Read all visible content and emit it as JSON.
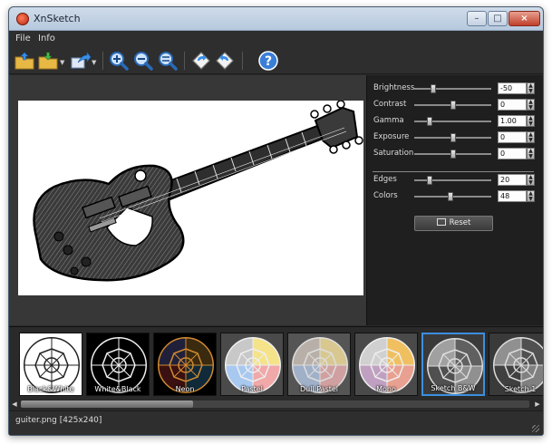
{
  "window": {
    "title": "XnSketch"
  },
  "menu": [
    "File",
    "Info"
  ],
  "toolbar": {
    "icons": [
      "open-folder",
      "save-folder",
      "export",
      "zoom-in",
      "zoom-out",
      "zoom-fit",
      "rotate-left",
      "rotate-right",
      "help"
    ]
  },
  "params": [
    {
      "label": "Brightness",
      "value": "-50",
      "level": 0.25
    },
    {
      "label": "Contrast",
      "value": "0",
      "level": 0.5
    },
    {
      "label": "Gamma",
      "value": "1.00",
      "level": 0.2
    },
    {
      "label": "Exposure",
      "value": "0",
      "level": 0.5
    },
    {
      "label": "Saturation",
      "value": "0",
      "level": 0.5
    },
    {
      "label": "Edges",
      "value": "20",
      "level": 0.2
    },
    {
      "label": "Colors",
      "value": "48",
      "level": 0.47
    }
  ],
  "reset_label": "Reset",
  "presets": [
    {
      "label": "Black&White",
      "selected": false
    },
    {
      "label": "White&Black",
      "selected": false
    },
    {
      "label": "Neon",
      "selected": false
    },
    {
      "label": "Pastel",
      "selected": false
    },
    {
      "label": "Dull Pastel",
      "selected": false
    },
    {
      "label": "Mono",
      "selected": false
    },
    {
      "label": "Sketch B&W",
      "selected": true
    },
    {
      "label": "Sketch 1",
      "selected": false
    }
  ],
  "status": {
    "text": "guiter.png [425x240]"
  },
  "colors": {
    "accent": "#3c8fe0",
    "panel_bg": "#1f1f1f",
    "canvas_bg": "#373737"
  }
}
